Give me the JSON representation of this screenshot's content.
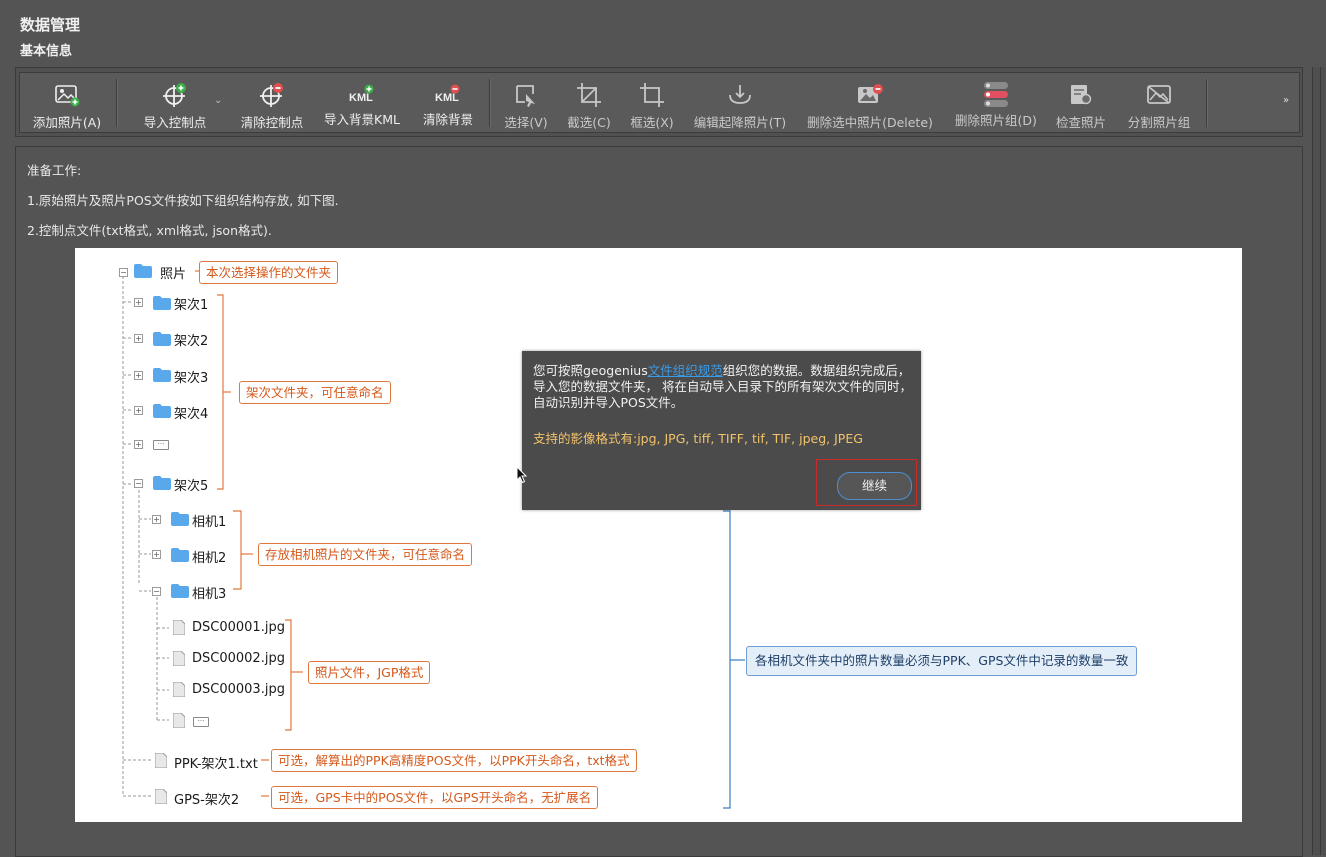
{
  "window": {
    "title": "数据管理",
    "subtitle": "基本信息"
  },
  "toolbar": {
    "buttons": [
      {
        "label": "添加照片(A)",
        "icon": "add-photo-icon"
      },
      {
        "label": "导入控制点",
        "icon": "import-control-point-icon"
      },
      {
        "label": "清除控制点",
        "icon": "clear-control-point-icon"
      },
      {
        "label": "导入背景KML",
        "icon": "import-kml-icon"
      },
      {
        "label": "清除背景",
        "icon": "clear-background-icon"
      },
      {
        "label": "选择(V)",
        "icon": "select-cursor-icon"
      },
      {
        "label": "截选(C)",
        "icon": "crop-icon"
      },
      {
        "label": "框选(X)",
        "icon": "box-select-icon"
      },
      {
        "label": "编辑起降照片(T)",
        "icon": "edit-takeoff-landing-icon"
      },
      {
        "label": "删除选中照片(Delete)",
        "icon": "delete-selected-photo-icon"
      },
      {
        "label": "删除照片组(D)",
        "icon": "delete-photo-group-icon"
      },
      {
        "label": "检查照片",
        "icon": "check-photo-icon"
      },
      {
        "label": "分割照片组",
        "icon": "split-photo-group-icon"
      }
    ],
    "overflow": "»"
  },
  "prep": {
    "line1": "准备工作:",
    "line2": "1.原始照片及照片POS文件按如下组织结构存放, 如下图.",
    "line3": "2.控制点文件(txt格式, xml格式, json格式)."
  },
  "diagram": {
    "root": "照片",
    "root_note": "本次选择操作的文件夹",
    "flights": [
      "架次1",
      "架次2",
      "架次3",
      "架次4",
      "架次5"
    ],
    "flights_note": "架次文件夹，可任意命名",
    "ellipsis": "···",
    "cameras": [
      "相机1",
      "相机2",
      "相机3"
    ],
    "cameras_note": "存放相机照片的文件夹，可任意命名",
    "photos": [
      "DSC00001.jpg",
      "DSC00002.jpg",
      "DSC00003.jpg"
    ],
    "photos_note": "照片文件，JGP格式",
    "ppk_file": "PPK-架次1.txt",
    "ppk_note": "可选，解算出的PPK高精度POS文件，以PPK开头命名，txt格式",
    "gps_file": "GPS-架次2",
    "gps_note": "可选，GPS卡中的POS文件，以GPS开头命名，无扩展名",
    "count_note": "各相机文件夹中的照片数量必须与PPK、GPS文件中记录的数量一致"
  },
  "dialog": {
    "msg_before": "您可按照geogenius",
    "msg_link": "文件组织规范",
    "msg_after": "组织您的数据。数据组织完成后，导入您的数据文件夹， 将在自动导入目录下的所有架次文件的同时，自动识别并导入POS文件。",
    "formats": "支持的影像格式有:jpg, JPG, tiff, TIFF, tif, TIF, jpeg, JPEG",
    "continue_label": "继续"
  },
  "colors": {
    "accent_orange": "#e1783b",
    "link_blue": "#3a9be8",
    "highlight_red": "#c72c2c",
    "format_text": "#f2c36b"
  }
}
